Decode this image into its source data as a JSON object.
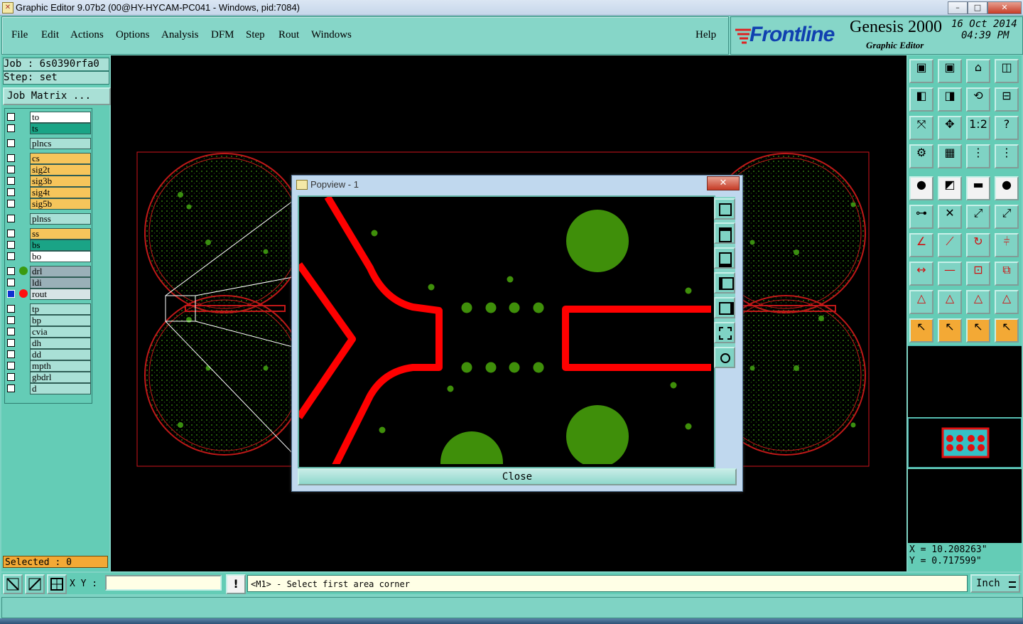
{
  "window": {
    "title": "Graphic Editor 9.07b2 (00@HY-HYCAM-PC041 - Windows, pid:7084)",
    "buttons": [
      "–",
      "□",
      "✕"
    ]
  },
  "menu": {
    "items": [
      "File",
      "Edit",
      "Actions",
      "Options",
      "Analysis",
      "DFM",
      "Step",
      "Rout",
      "Windows"
    ],
    "help": "Help"
  },
  "brand": {
    "logo": "Frontline",
    "product": "Genesis 2000",
    "subtitle": "Graphic Editor",
    "date": "16 Oct 2014",
    "time": "04:39 PM"
  },
  "job": {
    "job_label": "Job : 6s0390rfa0",
    "step_label": "Step: set",
    "matrix_button": "Job Matrix ..."
  },
  "layers": [
    {
      "name": "to",
      "color": "#ffffff"
    },
    {
      "name": "ts",
      "color": "#1aa486"
    },
    {
      "name": "plncs",
      "color": "#a9e0d6"
    },
    {
      "name": "cs",
      "color": "#f6c55b"
    },
    {
      "name": "sig2t",
      "color": "#f6c55b"
    },
    {
      "name": "sig3b",
      "color": "#f6c55b"
    },
    {
      "name": "sig4t",
      "color": "#f6c55b"
    },
    {
      "name": "sig5b",
      "color": "#f6c55b"
    },
    {
      "name": "plnss",
      "color": "#a9e0d6"
    },
    {
      "name": "ss",
      "color": "#f6c55b"
    },
    {
      "name": "bs",
      "color": "#1aa486"
    },
    {
      "name": "bo",
      "color": "#ffffff"
    },
    {
      "name": "drl",
      "color": "#9ab0b8"
    },
    {
      "name": "ldi",
      "color": "#9ab0b8"
    },
    {
      "name": "rout",
      "color": "#d7e4e6"
    },
    {
      "name": "tp",
      "color": "#a9e0d6"
    },
    {
      "name": "bp",
      "color": "#a9e0d6"
    },
    {
      "name": "cvia",
      "color": "#a9e0d6"
    },
    {
      "name": "dh",
      "color": "#a9e0d6"
    },
    {
      "name": "dd",
      "color": "#a9e0d6"
    },
    {
      "name": "mpth",
      "color": "#a9e0d6"
    },
    {
      "name": "gbdrl",
      "color": "#a9e0d6"
    },
    {
      "name": "d",
      "color": "#a9e0d6"
    }
  ],
  "selected": "Selected : 0",
  "popup": {
    "title": "Popview - 1",
    "close_label": "Close"
  },
  "coords": {
    "x": "X = 10.208263\"",
    "y": "Y = 0.717599\""
  },
  "status": {
    "xy_label": "X Y :",
    "xy_value": "",
    "message": "<M1> - Select first area corner",
    "unit": "Inch"
  },
  "colors": {
    "accent": "#64ccb6",
    "route": "#ff0000",
    "pad": "#3f8f0a"
  },
  "tools": [
    "pan-up",
    "pan-down",
    "home",
    "split-view",
    "pan-left",
    "pan-right",
    "zoom-back",
    "zoom-redraw",
    "zoom-fit",
    "zoom-center",
    "ratio-1-2",
    "help",
    "measure",
    "grid",
    "snap-1",
    "snap-2",
    "pad-select",
    "color-select",
    "ruler",
    "dot",
    "net",
    "cross",
    "line-select",
    "line-select-2",
    "angle",
    "line-draw",
    "arc",
    "feature-fill",
    "move",
    "horizontal",
    "frame",
    "copy",
    "tri-1",
    "tri-2",
    "tri-3",
    "tri-4",
    "pointer",
    "pointer-box",
    "pointer-circle",
    "pointer-net"
  ]
}
